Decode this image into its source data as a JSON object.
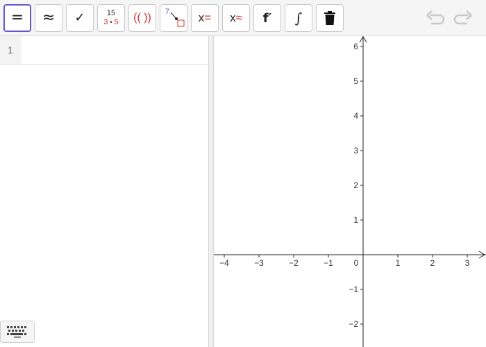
{
  "toolbar": {
    "buttons": [
      {
        "name": "exact-button",
        "symbol": "="
      },
      {
        "name": "numeric-button",
        "symbol": "≈"
      },
      {
        "name": "check-button",
        "symbol": "✓"
      },
      {
        "name": "factor-button",
        "top": "15",
        "bottom_a": "3",
        "bottom_dot": "•",
        "bottom_b": "5"
      },
      {
        "name": "expand-button",
        "symbol": "(( ))"
      },
      {
        "name": "substitute-button",
        "num": "7"
      },
      {
        "name": "solve-button",
        "x": "x",
        "rel": "="
      },
      {
        "name": "nsolve-button",
        "x": "x",
        "rel": "≈"
      },
      {
        "name": "derivative-button",
        "symbol": "f′"
      },
      {
        "name": "integral-button",
        "symbol": "∫"
      },
      {
        "name": "delete-button"
      }
    ]
  },
  "algebra": {
    "rows": [
      {
        "number": "1",
        "value": ""
      }
    ]
  },
  "graphics": {
    "x_ticks": [
      "−4",
      "−3",
      "−2",
      "−1",
      "0",
      "1",
      "2",
      "3"
    ],
    "y_ticks": [
      "6",
      "5",
      "4",
      "3",
      "2",
      "1",
      "−1",
      "−2"
    ]
  },
  "colors": {
    "accent": "#6557d2",
    "red": "#d32f2f"
  }
}
